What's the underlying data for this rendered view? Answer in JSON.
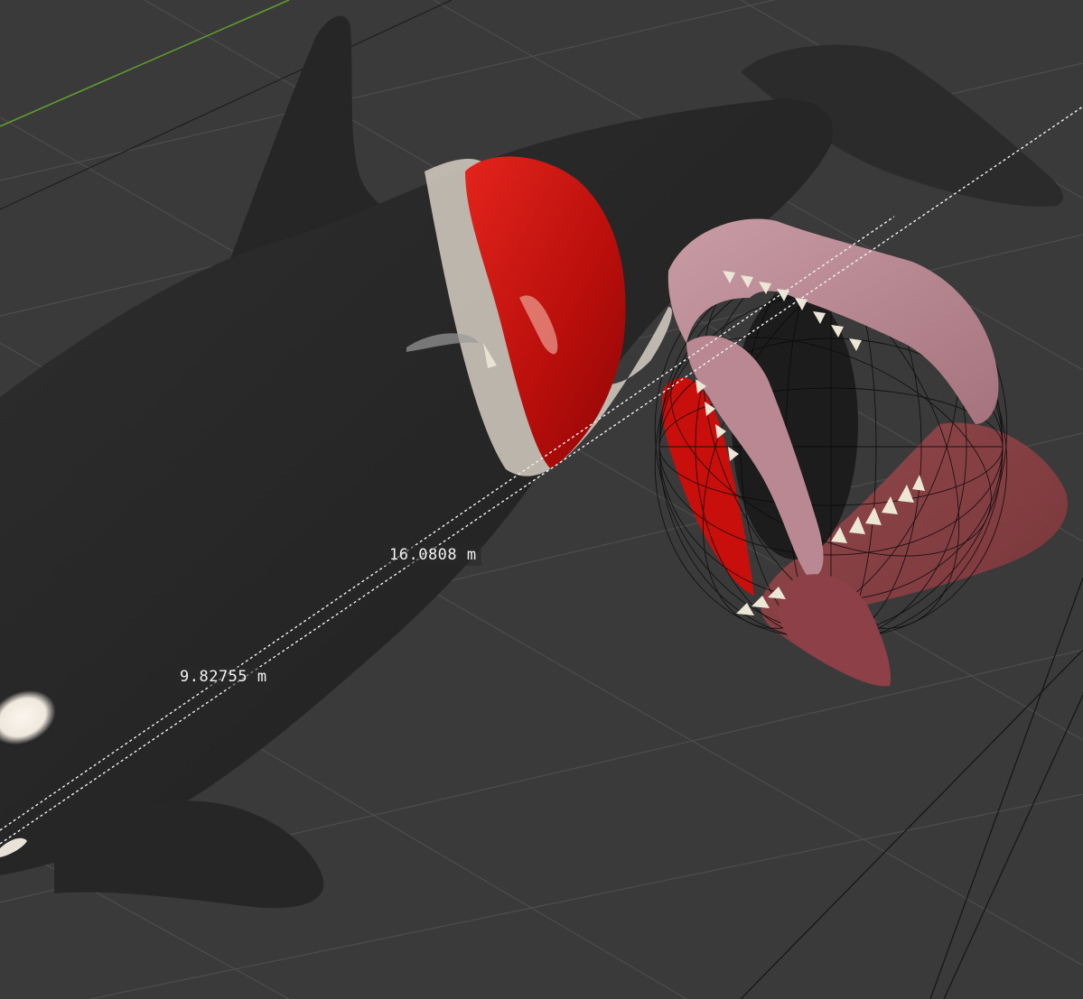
{
  "viewport": {
    "background_color": "#3a3a3a",
    "grid_color": "#4c4c4c",
    "x_axis_color": "#5f9e2f"
  },
  "measurements": {
    "long_label": "16.0808 m",
    "short_label": "9.82755 m"
  },
  "model": {
    "body_color": "#2a2a2a",
    "mouth_interior_color": "#c8120f",
    "tongue_color": "#b98892",
    "teeth_color": "#e8e2d2",
    "eye_patch_color": "#f4eee6",
    "wireframe_color": "#0a0a0a"
  }
}
